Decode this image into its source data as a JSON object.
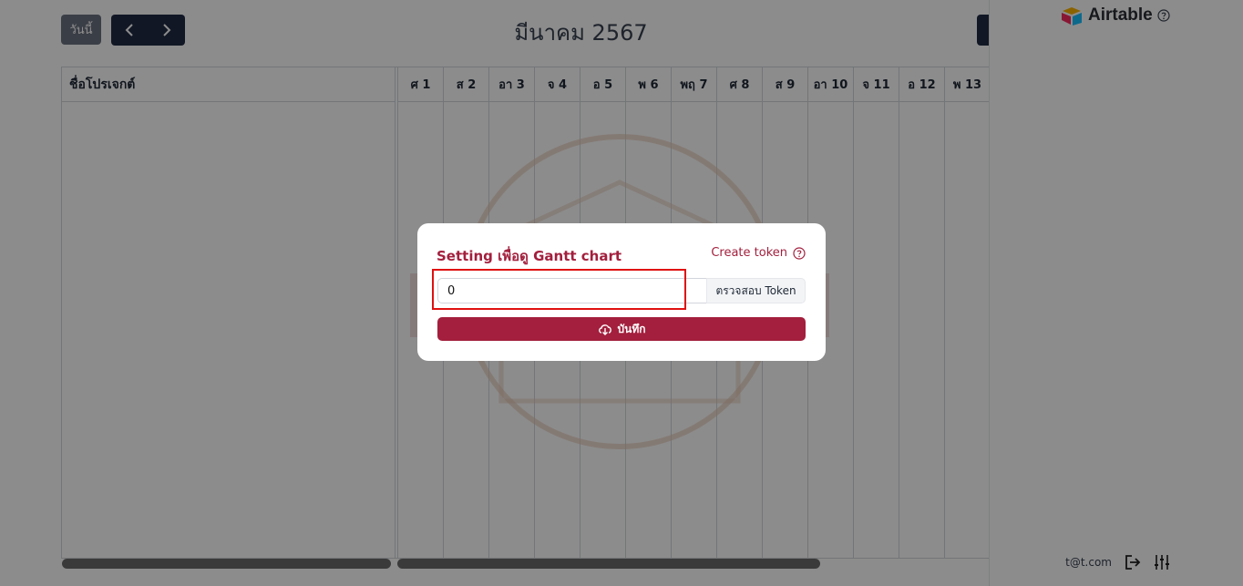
{
  "toolbar": {
    "today_label": "วันนี้",
    "month_title": "มีนาคม 2567"
  },
  "grid": {
    "project_header": "ชื่อโปรเจกต์",
    "days": [
      "ศ 1",
      "ส 2",
      "อา 3",
      "จ 4",
      "อ 5",
      "พ 6",
      "พฤ 7",
      "ศ 8",
      "ส 9",
      "อา 10",
      "จ 11",
      "อ 12",
      "พ 13"
    ]
  },
  "sidebar": {
    "brand": "Airtable",
    "user_email": "t@t.com"
  },
  "modal": {
    "title": "Setting เพื่อดู Gantt chart",
    "create_token_label": "Create token",
    "token_value": "0",
    "check_token_label": "ตรวจสอบ Token",
    "save_label": "บันทึก"
  },
  "colors": {
    "accent": "#a31f3d",
    "highlight": "#e01010",
    "nav_dark": "#1f2a44"
  }
}
